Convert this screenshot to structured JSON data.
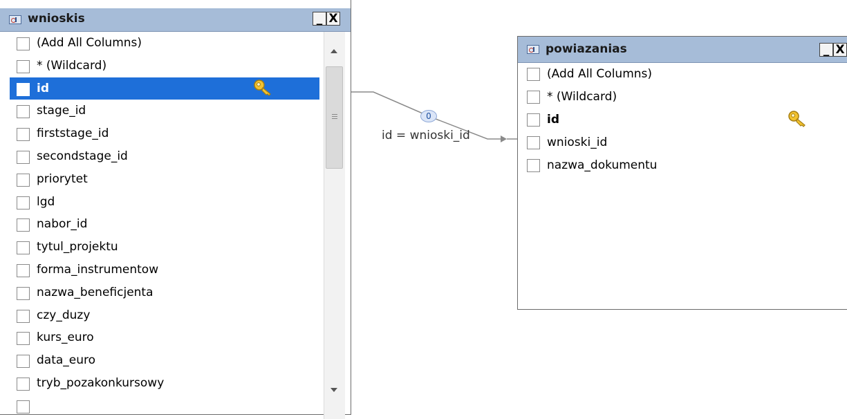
{
  "tables": [
    {
      "title": "wnioskis",
      "min_label": "_",
      "close_label": "X",
      "columns": [
        {
          "label": "(Add All Columns)"
        },
        {
          "label": "* (Wildcard)"
        },
        {
          "label": "id",
          "primary_key": true,
          "selected": true
        },
        {
          "label": "stage_id"
        },
        {
          "label": "firststage_id"
        },
        {
          "label": "secondstage_id"
        },
        {
          "label": "priorytet"
        },
        {
          "label": "lgd"
        },
        {
          "label": "nabor_id"
        },
        {
          "label": "tytul_projektu"
        },
        {
          "label": "forma_instrumentow"
        },
        {
          "label": "nazwa_beneficjenta"
        },
        {
          "label": "czy_duzy"
        },
        {
          "label": "kurs_euro"
        },
        {
          "label": "data_euro"
        },
        {
          "label": "tryb_pozakonkursowy"
        }
      ]
    },
    {
      "title": "powiazanias",
      "min_label": "_",
      "close_label": "X",
      "columns": [
        {
          "label": "(Add All Columns)"
        },
        {
          "label": "* (Wildcard)"
        },
        {
          "label": "id",
          "primary_key": true
        },
        {
          "label": "wnioski_id"
        },
        {
          "label": "nazwa_dokumentu"
        }
      ]
    }
  ],
  "join": {
    "label": "id = wnioski_id",
    "badge": "0"
  },
  "colors": {
    "titlebar": "#a6bcd8",
    "selection": "#1e6fd9",
    "key": "#f2c230"
  },
  "icons": [
    "table-icon",
    "key-icon",
    "minimize-icon",
    "close-icon",
    "scroll-up-icon",
    "scroll-down-icon"
  ]
}
